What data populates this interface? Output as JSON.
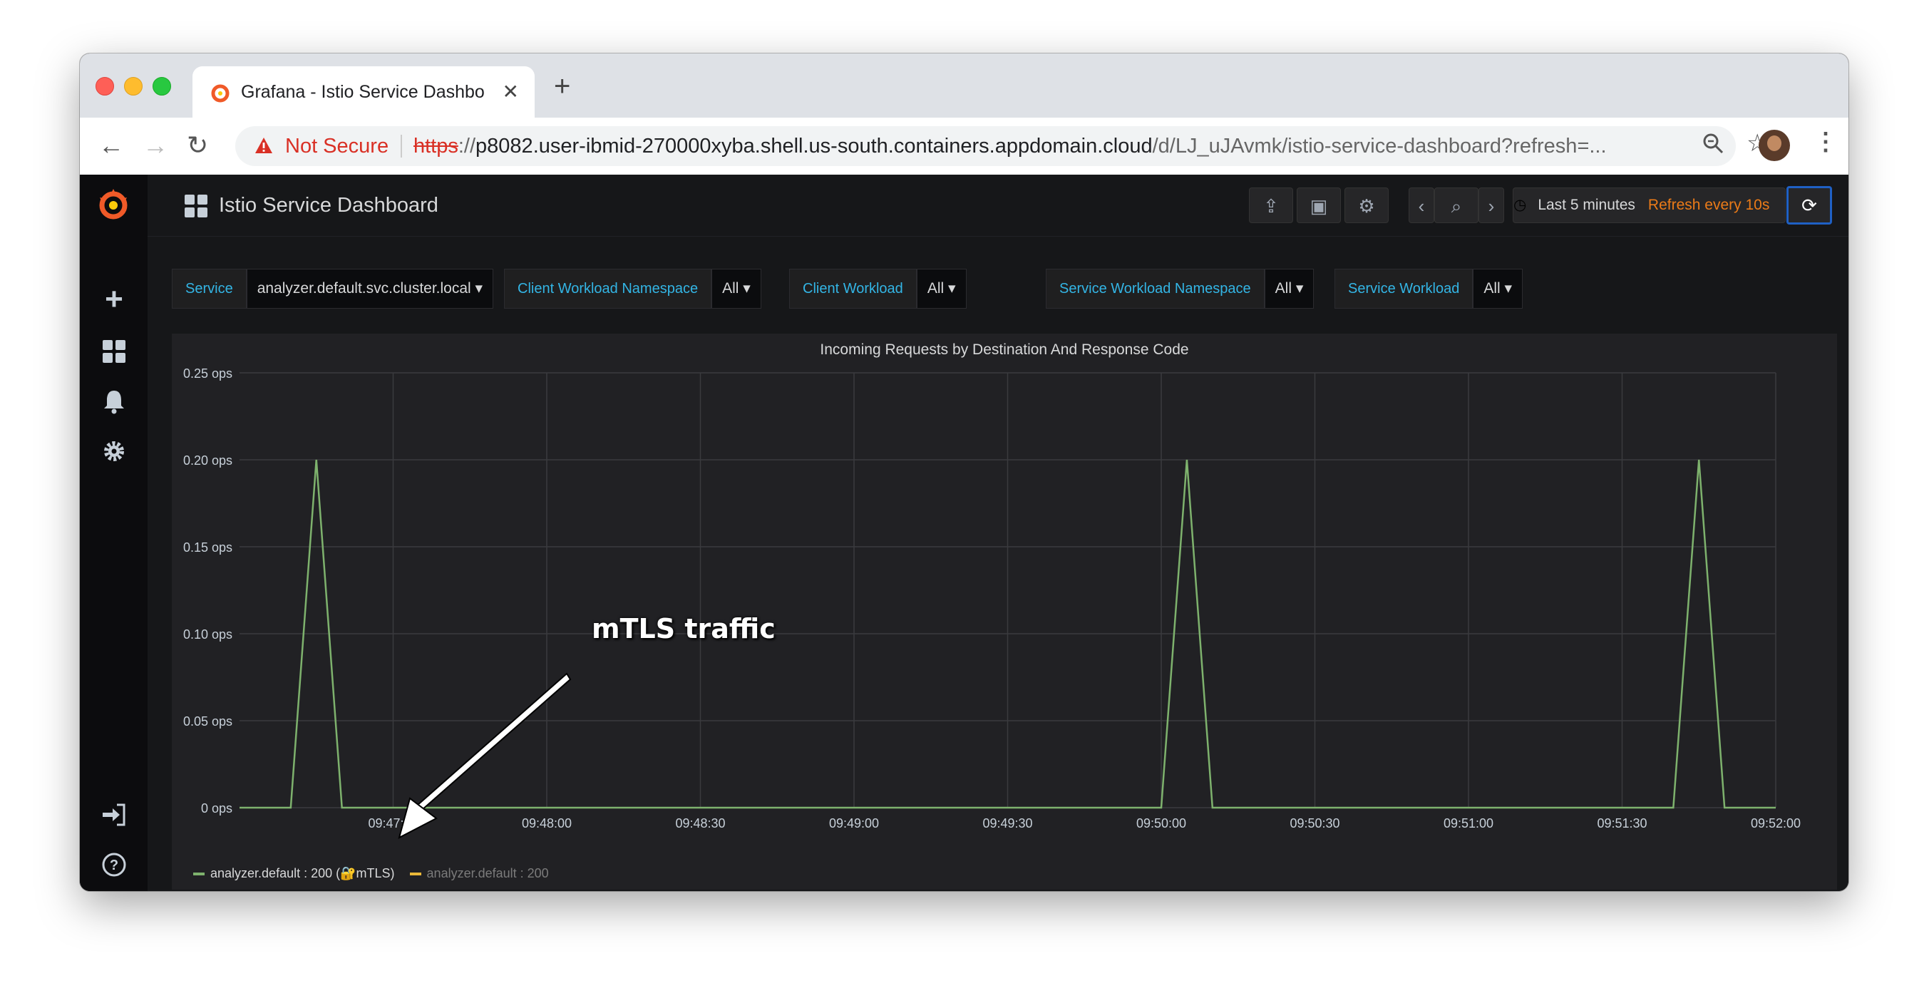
{
  "browser": {
    "tab_title": "Grafana - Istio Service Dashbo",
    "not_secure": "Not Secure",
    "url_scheme": "https",
    "url_sep": "://",
    "url_host": "p8082.user-ibmid-270000xyba.shell.us-south.containers.appdomain.cloud",
    "url_path": "/d/LJ_uJAvmk/istio-service-dashboard?refresh=..."
  },
  "dashboard": {
    "title": "Istio Service Dashboard",
    "time_range": "Last 5 minutes",
    "refresh": "Refresh every 10s"
  },
  "variables": [
    {
      "label": "Service",
      "value": "analyzer.default.svc.cluster.local"
    },
    {
      "label": "Client Workload Namespace",
      "value": "All"
    },
    {
      "label": "Client Workload",
      "value": "All"
    },
    {
      "label": "Service Workload Namespace",
      "value": "All"
    },
    {
      "label": "Service Workload",
      "value": "All"
    }
  ],
  "annotation": "mTLS traffic",
  "chart_data": {
    "type": "line",
    "title": "Incoming Requests by Destination And Response Code",
    "y_ticks": [
      "0.25 ops",
      "0.20 ops",
      "0.15 ops",
      "0.10 ops",
      "0.05 ops",
      "0 ops"
    ],
    "x_ticks": [
      "09:47:30",
      "09:48:00",
      "09:48:30",
      "09:49:00",
      "09:49:30",
      "09:50:00",
      "09:50:30",
      "09:51:00",
      "09:51:30",
      "09:52:00"
    ],
    "ylim": [
      0,
      0.25
    ],
    "grid": true,
    "legend_position": "bottom-left",
    "series": [
      {
        "name": "analyzer.default : 200 (🔐mTLS)",
        "color": "#7eb26d",
        "x": [
          "09:47:00",
          "09:47:10",
          "09:47:15",
          "09:47:20",
          "09:50:00",
          "09:50:05",
          "09:50:10",
          "09:51:40",
          "09:51:45",
          "09:51:50",
          "09:52:00"
        ],
        "values": [
          0,
          0,
          0.2,
          0,
          0,
          0.2,
          0,
          0,
          0.2,
          0,
          0
        ]
      },
      {
        "name": "analyzer.default : 200",
        "color": "#eab839",
        "x": [],
        "values": []
      }
    ]
  }
}
